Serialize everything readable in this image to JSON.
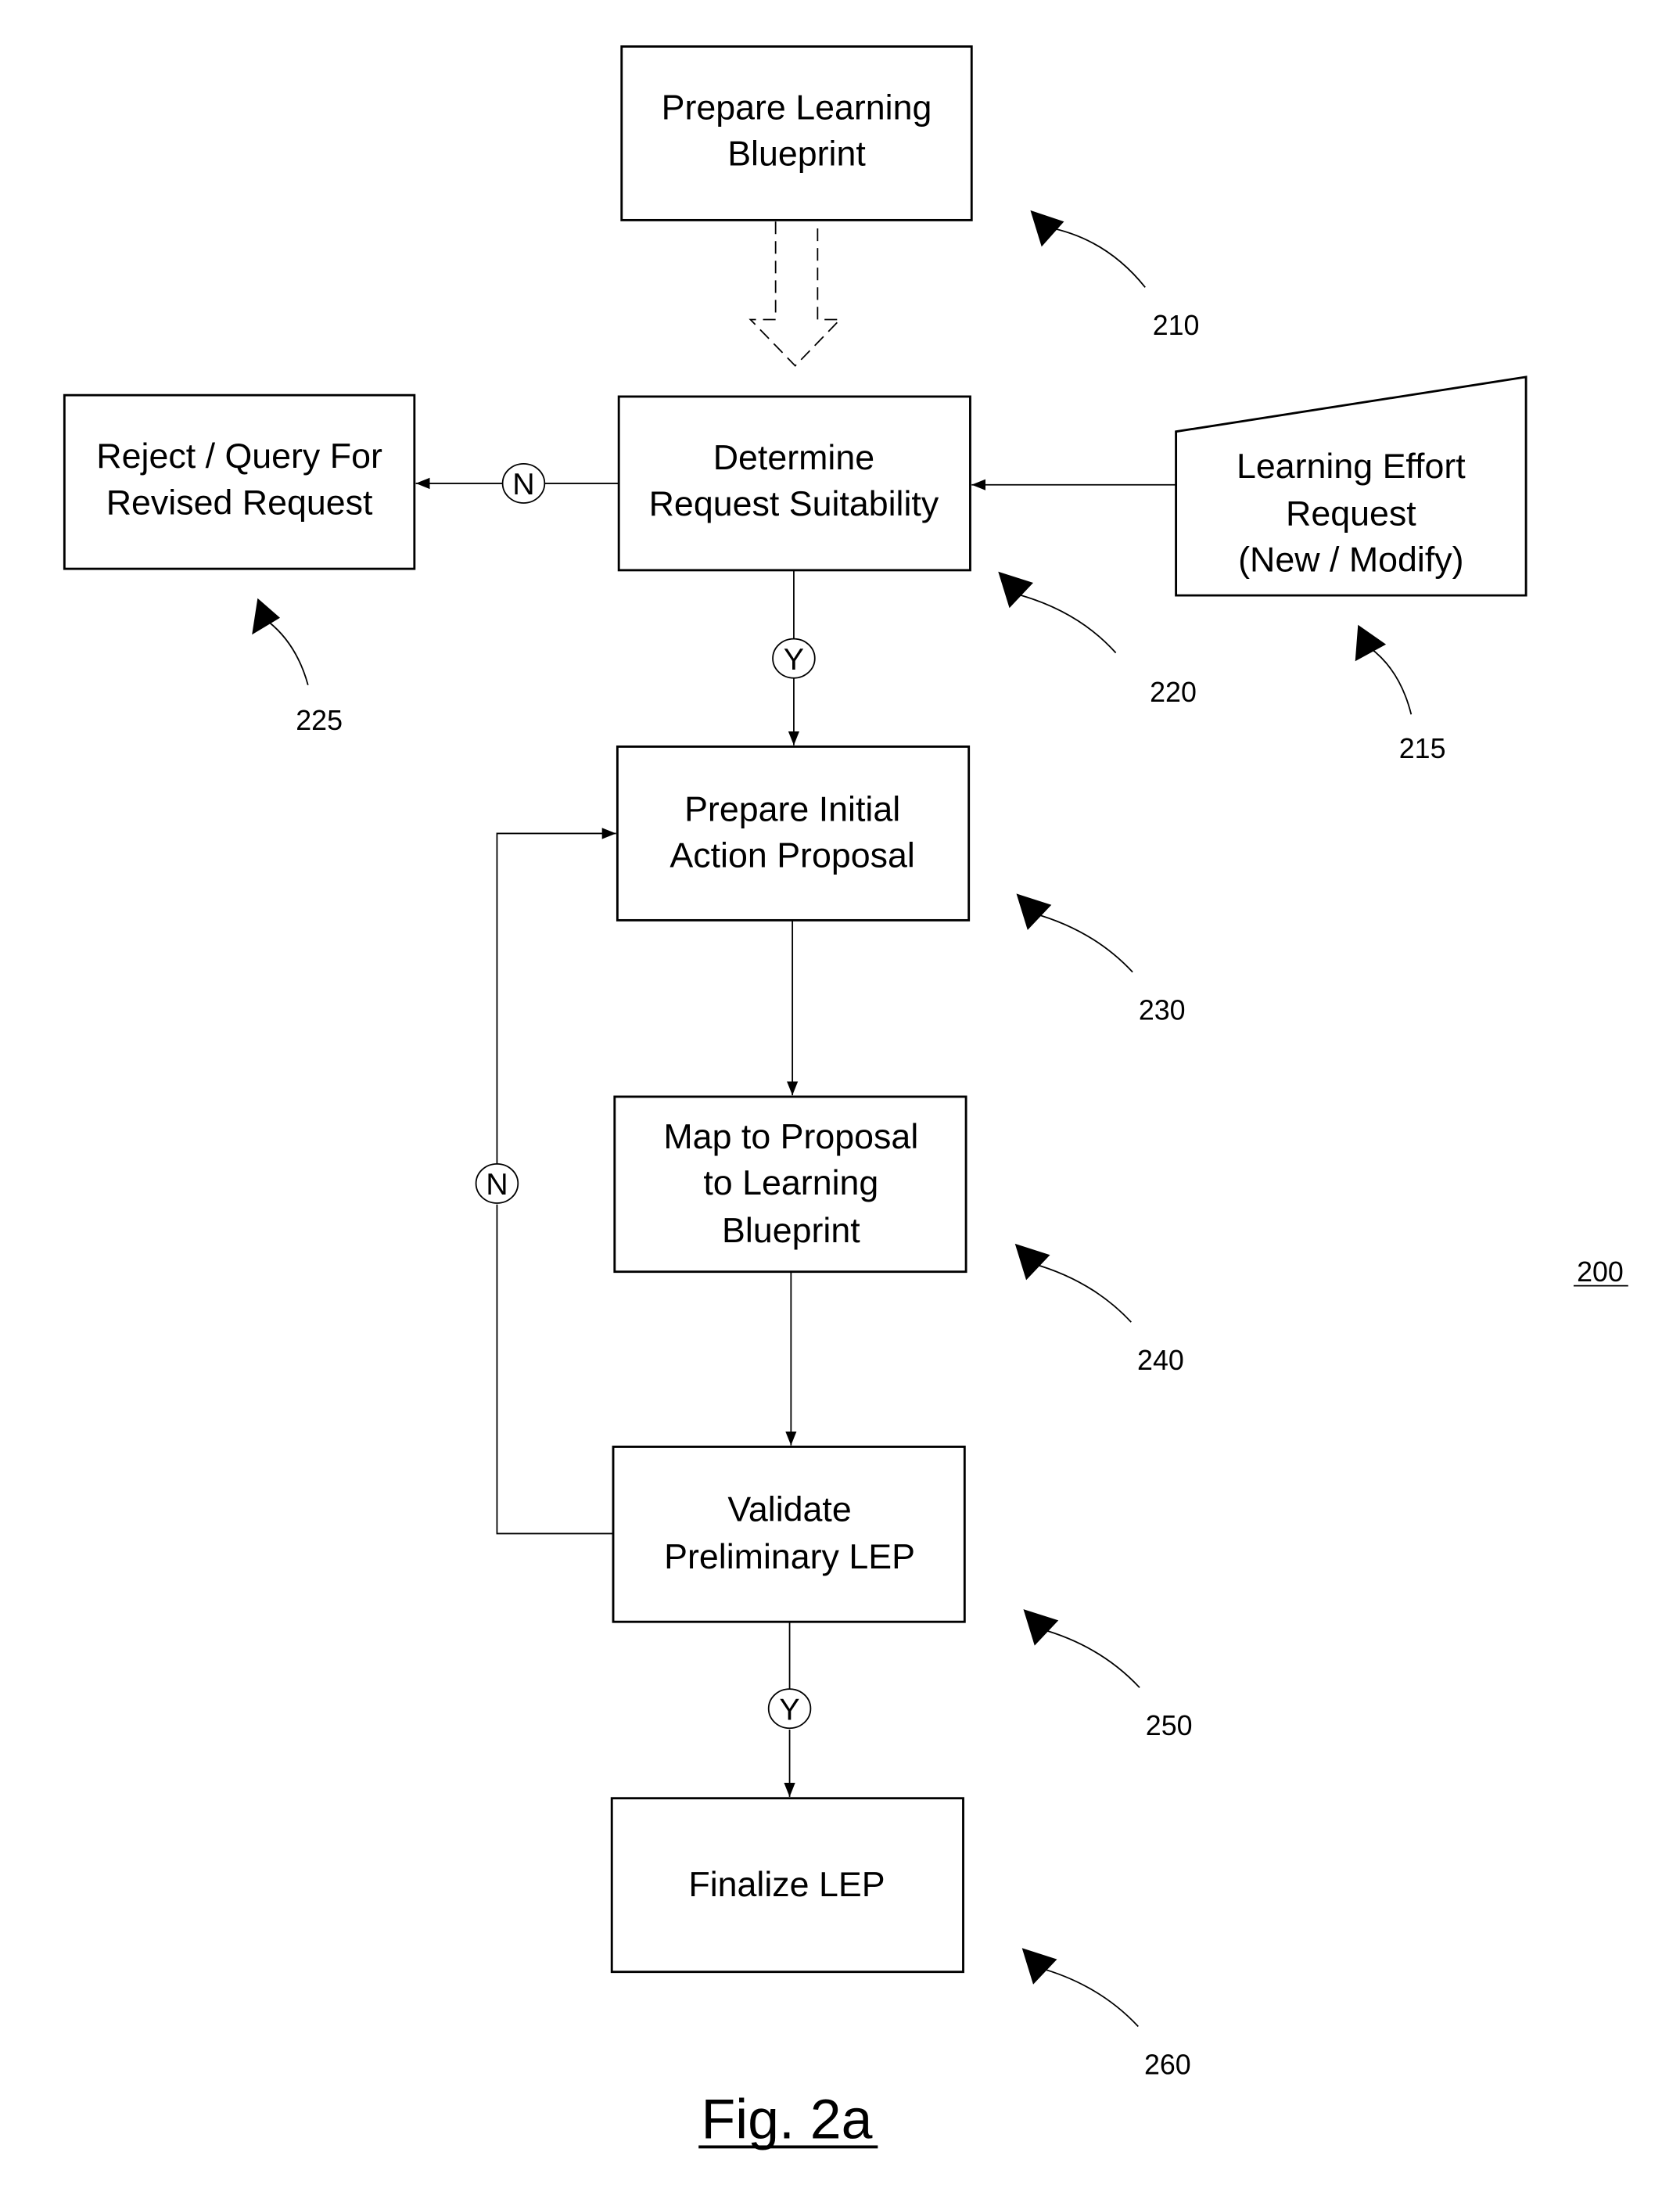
{
  "figure": {
    "caption": "Fig. 2a",
    "reference": "200"
  },
  "nodes": {
    "n210": {
      "lines": [
        "Prepare Learning",
        "Blueprint"
      ],
      "ref": "210"
    },
    "n220": {
      "lines": [
        "Determine",
        "Request Suitability"
      ],
      "ref": "220"
    },
    "n215": {
      "lines": [
        "Learning Effort",
        "Request",
        "(New / Modify)"
      ],
      "ref": "215"
    },
    "n225": {
      "lines": [
        "Reject / Query For",
        "Revised Request"
      ],
      "ref": "225"
    },
    "n230": {
      "lines": [
        "Prepare Initial",
        "Action Proposal"
      ],
      "ref": "230"
    },
    "n240": {
      "lines": [
        "Map to Proposal",
        "to Learning",
        "Blueprint"
      ],
      "ref": "240"
    },
    "n250": {
      "lines": [
        "Validate",
        "Preliminary LEP"
      ],
      "ref": "250"
    },
    "n260": {
      "lines": [
        "Finalize LEP"
      ],
      "ref": "260"
    }
  },
  "decisions": {
    "d220_no": "N",
    "d220_yes": "Y",
    "d250_no": "N",
    "d250_yes": "Y"
  }
}
